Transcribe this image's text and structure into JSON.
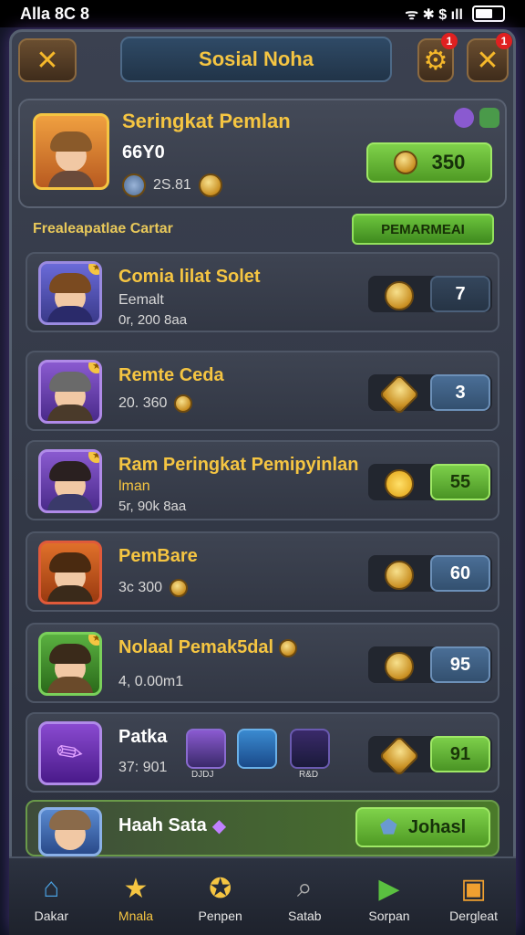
{
  "status_bar": {
    "time": "Alla 8C 8",
    "signal": "ᯤ ✱ $ ıll"
  },
  "header": {
    "title": "Sosial Noha",
    "left_button": "✕",
    "settings_badge": "1",
    "close_badge": "1"
  },
  "top_player": {
    "name": "Seringkat Pemlan",
    "score": "66Y0",
    "stat": "2S.81",
    "button_value": "350"
  },
  "section": {
    "label": "Frealeapatlae Cartar",
    "button": "PEMARMEAI"
  },
  "rows": [
    {
      "name": "Comia lilat Solet",
      "line1": "Eemalt",
      "line2": "0r, 200 8aa",
      "value": "7"
    },
    {
      "name": "Remte Ceda",
      "line1": "",
      "line2": "20. 360",
      "value": "3"
    },
    {
      "name": "Ram Peringkat Pemipyinlan",
      "line1": "lman",
      "line2": "5r, 90k 8aa",
      "value": "55"
    },
    {
      "name": "PemBare",
      "line1": "",
      "line2": "3c 300",
      "value": "60"
    },
    {
      "name": "Nolaal Pemak5dal",
      "line1": "",
      "line2": "4, 0.00m1",
      "value": "95"
    },
    {
      "name": "Patka",
      "line1": "",
      "line2": "37: 901",
      "value": "91",
      "item_label_1": "DJDJ",
      "item_label_2": "R&D"
    }
  ],
  "last_row": {
    "name": "Haah Sata",
    "button": "Johasl"
  },
  "nav": [
    {
      "label": "Dakar",
      "icon": "castle-icon"
    },
    {
      "label": "Mnala",
      "icon": "star-icon"
    },
    {
      "label": "Penpen",
      "icon": "medal-icon"
    },
    {
      "label": "Satab",
      "icon": "search-icon"
    },
    {
      "label": "Sorpan",
      "icon": "play-icon"
    },
    {
      "label": "Dergleat",
      "icon": "chest-icon"
    }
  ],
  "colors": {
    "gold": "#f5c542",
    "green": "#7fd24a",
    "blue": "#4a6e96",
    "panel": "#3b4150"
  }
}
